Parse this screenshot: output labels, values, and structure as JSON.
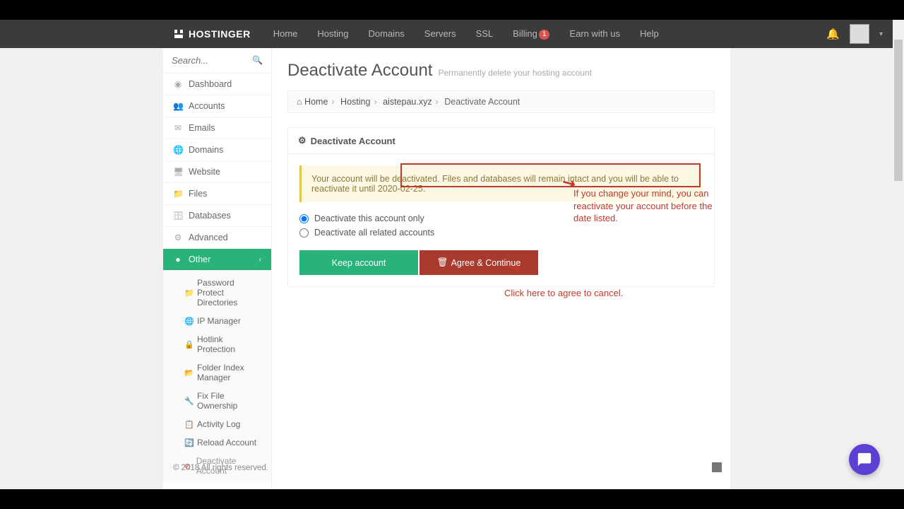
{
  "brand": "HOSTINGER",
  "nav": {
    "home": "Home",
    "hosting": "Hosting",
    "domains": "Domains",
    "servers": "Servers",
    "ssl": "SSL",
    "billing": "Billing",
    "billing_badge": "1",
    "earn": "Earn with us",
    "help": "Help"
  },
  "search": {
    "placeholder": "Search..."
  },
  "sidebar": {
    "items": [
      {
        "icon": "◉",
        "label": "Dashboard"
      },
      {
        "icon": "👥",
        "label": "Accounts"
      },
      {
        "icon": "✉",
        "label": "Emails"
      },
      {
        "icon": "🌐",
        "label": "Domains"
      },
      {
        "icon": "🖥",
        "label": "Website"
      },
      {
        "icon": "📁",
        "label": "Files"
      },
      {
        "icon": "🗄",
        "label": "Databases"
      },
      {
        "icon": "⚙",
        "label": "Advanced"
      }
    ],
    "active": {
      "icon": "●",
      "label": "Other",
      "chev": "‹"
    },
    "sub": [
      {
        "icon": "📁",
        "cls": "si-brown",
        "label": "Password Protect Directories"
      },
      {
        "icon": "🌐",
        "cls": "si-dark",
        "label": "IP Manager"
      },
      {
        "icon": "🔒",
        "cls": "si-dark",
        "label": "Hotlink Protection"
      },
      {
        "icon": "📂",
        "cls": "si-brown",
        "label": "Folder Index Manager"
      },
      {
        "icon": "🔧",
        "cls": "si-dark",
        "label": "Fix File Ownership"
      },
      {
        "icon": "📋",
        "cls": "si-dark",
        "label": "Activity Log"
      },
      {
        "icon": "🔄",
        "cls": "si-blue",
        "label": "Reload Account"
      },
      {
        "icon": "⊘",
        "cls": "si-red",
        "label": "Deactivate Account"
      }
    ]
  },
  "page": {
    "title": "Deactivate Account",
    "subtitle": "Permanently delete your hosting account"
  },
  "breadcrumb": {
    "home": "Home",
    "l2": "Hosting",
    "l3": "aistepau.xyz",
    "l4": "Deactivate Account"
  },
  "panel": {
    "heading": "Deactivate Account",
    "alert": "Your account will be deactivated. Files and databases will remain intact and you will be able to reactivate it until 2020-02-25.",
    "opt1": "Deactivate this account only",
    "opt2": "Deactivate all related accounts",
    "keep": "Keep account",
    "agree": "Agree & Continue"
  },
  "annotations": {
    "a1": "If you change your mind, you can reactivate your account before the date listed.",
    "a2": "Click here to agree to cancel."
  },
  "footer": "© 2018 All rights reserved."
}
